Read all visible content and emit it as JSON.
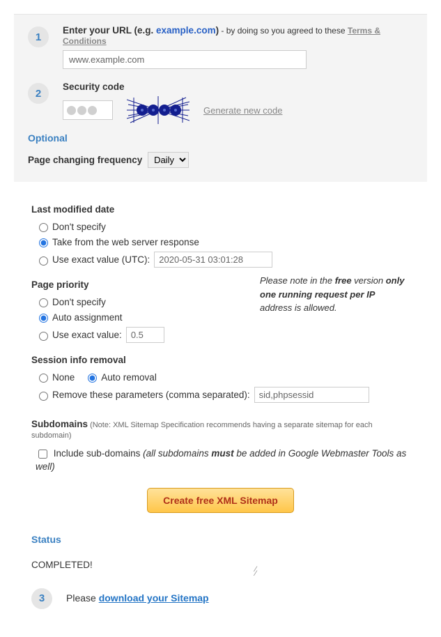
{
  "step1": {
    "label_prefix": "Enter your URL (e.g. ",
    "example": "example.com",
    "label_suffix": ")",
    "agree_text": " - by doing so you agreed to these ",
    "terms": "Terms & Conditions",
    "url_value": "www.example.com"
  },
  "step2": {
    "label": "Security code",
    "generate": "Generate new code"
  },
  "optional": {
    "title": "Optional",
    "freq_label": "Page changing frequency",
    "freq_value": "Daily"
  },
  "lastmod": {
    "label": "Last modified date",
    "opt1": "Don't specify",
    "opt2": "Take from the web server response",
    "opt3": "Use exact value (UTC):",
    "value": "2020-05-31 03:01:28"
  },
  "priority": {
    "label": "Page priority",
    "opt1": "Don't specify",
    "opt2": "Auto assignment",
    "opt3": "Use exact value:",
    "value": "0.5",
    "note_pre": "Please note in the ",
    "note_free": "free",
    "note_mid1": " version ",
    "note_only": "only one running request per IP",
    "note_post": " address is allowed."
  },
  "session": {
    "label": "Session info removal",
    "opt1": "None",
    "opt2": "Auto removal",
    "opt3": "Remove these parameters (comma separated):",
    "value": "sid,phpsessid"
  },
  "subdomains": {
    "label": "Subdomains",
    "note": " (Note: XML Sitemap Specification recommends having a separate sitemap for each subdomain)",
    "check_pre": "Include sub-domains ",
    "check_italic1": "(all subdomains ",
    "check_must": "must",
    "check_italic2": " be added in Google Webmaster Tools as well)"
  },
  "button": "Create free XML Sitemap",
  "status": {
    "title": "Status",
    "completed": "COMPLETED!",
    "please": "Please ",
    "download": "download your Sitemap"
  }
}
